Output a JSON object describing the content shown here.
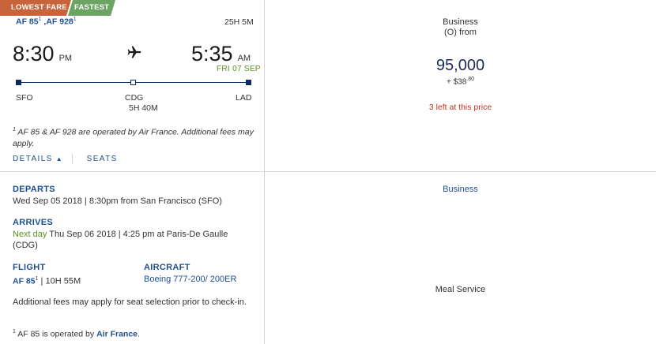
{
  "badges": {
    "lowest_fare": "LOWEST FARE",
    "fastest": "FASTEST"
  },
  "flight": {
    "flight_1": "AF 85",
    "flight_1_sup": "1",
    "separator": " ,",
    "flight_2": "AF 928",
    "flight_2_sup": "1",
    "total_duration": "25H 5M",
    "departure_time": "8:30",
    "departure_ampm": "PM",
    "arrival_time": "5:35",
    "arrival_ampm": "AM",
    "arrival_date": "FRI 07 SEP",
    "origin": "SFO",
    "connection": "CDG",
    "layover": "5H 40M",
    "destination": "LAD",
    "operated_note_sup": "1",
    "operated_note": " AF 85 & AF 928 are operated by Air France. Additional fees may apply."
  },
  "tabs": {
    "details": "DETAILS",
    "details_arrow": "▲",
    "seats": "SEATS"
  },
  "fare": {
    "cabin": "Business",
    "fare_code": "(O) from",
    "points": "95,000",
    "fee_prefix": "+ $38",
    "fee_cents": ".80",
    "seats_left": "3 left at this price"
  },
  "details": {
    "departs_label": "DEPARTS",
    "departs_value": "Wed Sep 05 2018 | 8:30pm from San Francisco (SFO)",
    "arrives_label": "ARRIVES",
    "arrives_next_day": "Next day",
    "arrives_value": " Thu Sep 06 2018 | 4:25 pm at Paris-De Gaulle (CDG)",
    "flight_label": "FLIGHT",
    "flight_number": "AF 85",
    "flight_number_sup": "1",
    "flight_duration": " | 10H 55M",
    "aircraft_label": "AIRCRAFT",
    "aircraft_value": "Boeing 777-200/ 200ER",
    "seat_note": "Additional fees may apply for seat selection prior to check-in.",
    "footnote_sup": "1",
    "footnote_text": " AF 85 is operated by ",
    "footnote_airline": "Air France",
    "footnote_end": "."
  },
  "amenities": {
    "cabin": "Business",
    "meal": "Meal Service"
  },
  "colors": {
    "brand_blue": "#1f4f8f",
    "lowest_fare_badge": "#c8643b",
    "fastest_badge": "#6ba463",
    "alert_red": "#c3311d",
    "date_green": "#5b8f1e"
  },
  "icons": {
    "plane": "airplane-icon"
  }
}
